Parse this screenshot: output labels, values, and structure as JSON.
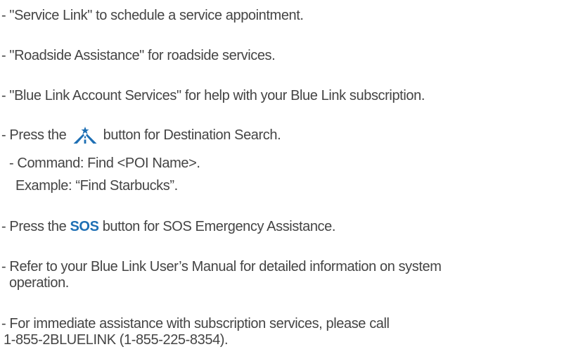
{
  "items": {
    "service_link": "- \"Service Link\" to schedule a service appointment.",
    "roadside": "- \"Roadside Assistance\" for roadside services.",
    "account": "- \"Blue Link Account Services\" for help with your Blue Link subscription.",
    "destination_pre": "- Press the",
    "destination_post": "button for Destination Search.",
    "destination_icon": "destination-search-icon",
    "command": "- Command: Find <POI Name>.",
    "example": "Example: “Find Starbucks”.",
    "sos_pre": "- Press the",
    "sos_label": "SOS",
    "sos_post": "button for SOS Emergency Assistance.",
    "manual_line1": "- Refer to your Blue Link User’s Manual for detailed information on system",
    "manual_line2": "operation.",
    "immediate_line1": "- For immediate assistance with subscription services, please call",
    "immediate_line2": "1-855-2BLUELINK (1-855-225-8354)."
  },
  "colors": {
    "text": "#444444",
    "sos": "#1e6fb4",
    "icon": "#1e6fb4"
  }
}
